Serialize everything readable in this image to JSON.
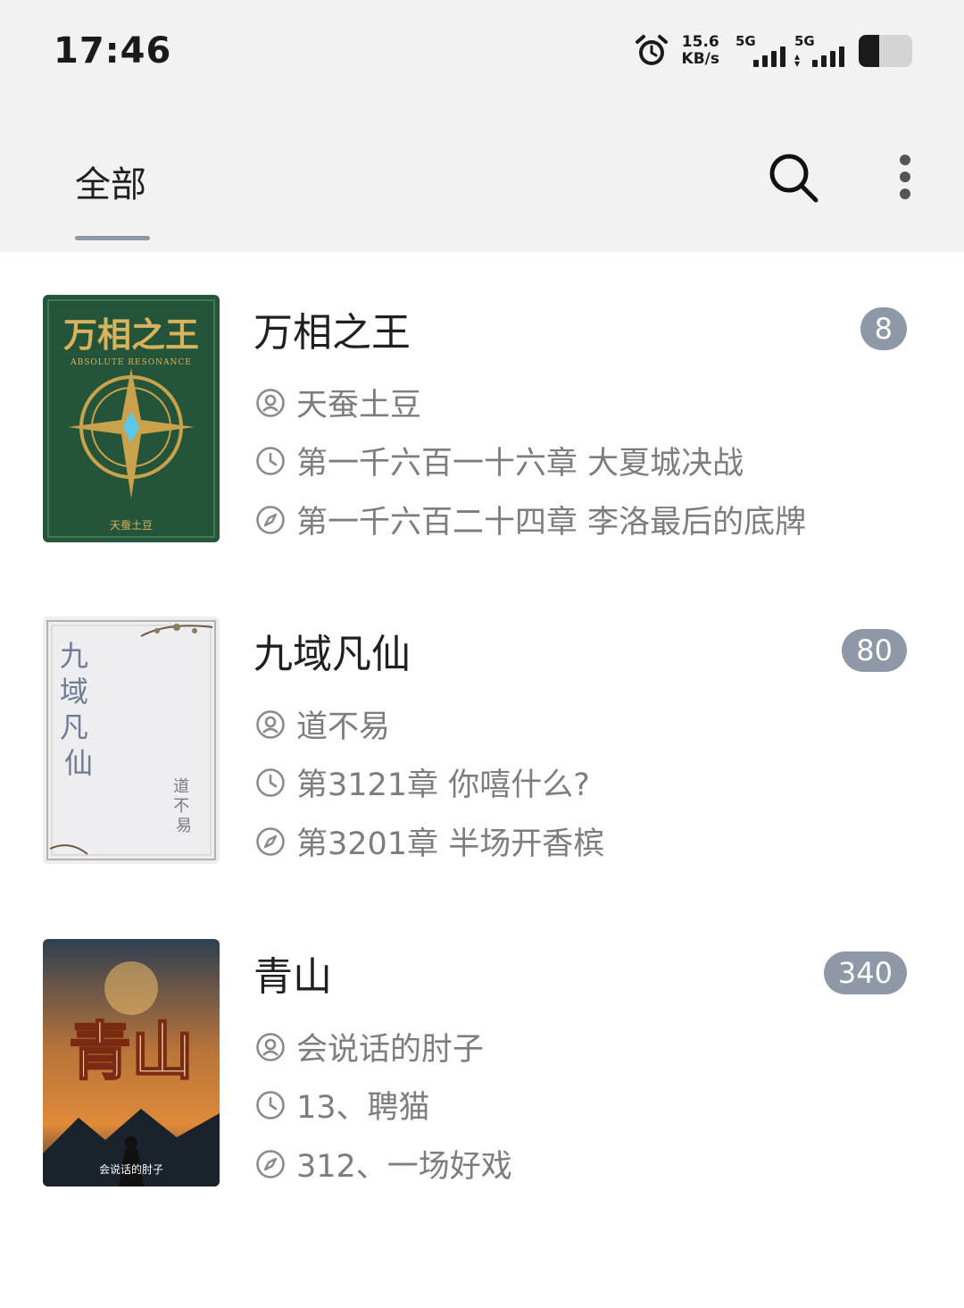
{
  "status_bar": {
    "time": "17:46",
    "net_speed_value": "15.6",
    "net_speed_unit": "KB/s",
    "sim1_label": "5G",
    "sim2_label": "5G",
    "battery_level_fraction": 0.38
  },
  "header": {
    "tab_all_label": "全部",
    "search_icon": "search-icon",
    "more_icon": "more-vertical-icon"
  },
  "books": [
    {
      "title": "万相之王",
      "badge": "8",
      "author": "天蚕土豆",
      "last_read": "第一千六百一十六章 大夏城决战",
      "latest": "第一千六百二十四章 李洛最后的底牌",
      "cover": {
        "title_text": "万相之王",
        "subtitle_text": "ABSOLUTE RESONANCE",
        "author_text": "天蚕土豆",
        "base_color": "#24553a",
        "accent_color": "#c9a24b"
      }
    },
    {
      "title": "九域凡仙",
      "badge": "80",
      "author": "道不易",
      "last_read": "第3121章 你嘻什么?",
      "latest": "第3201章 半场开香槟",
      "cover": {
        "title_text": "九域凡仙",
        "author_text": "道不易",
        "base_color": "#eeeef0",
        "accent_color": "#6f7c94"
      }
    },
    {
      "title": "青山",
      "badge": "340",
      "author": "会说话的肘子",
      "last_read": "13、聘猫",
      "latest": "312、一场好戏",
      "cover": {
        "title_text": "青山",
        "author_text": "会说话的肘子",
        "base_color": "#2e3f52",
        "accent_color": "#e08a3a"
      }
    }
  ],
  "icons": {
    "author": "user-circle-icon",
    "last_read": "clock-icon",
    "latest": "compass-icon"
  }
}
